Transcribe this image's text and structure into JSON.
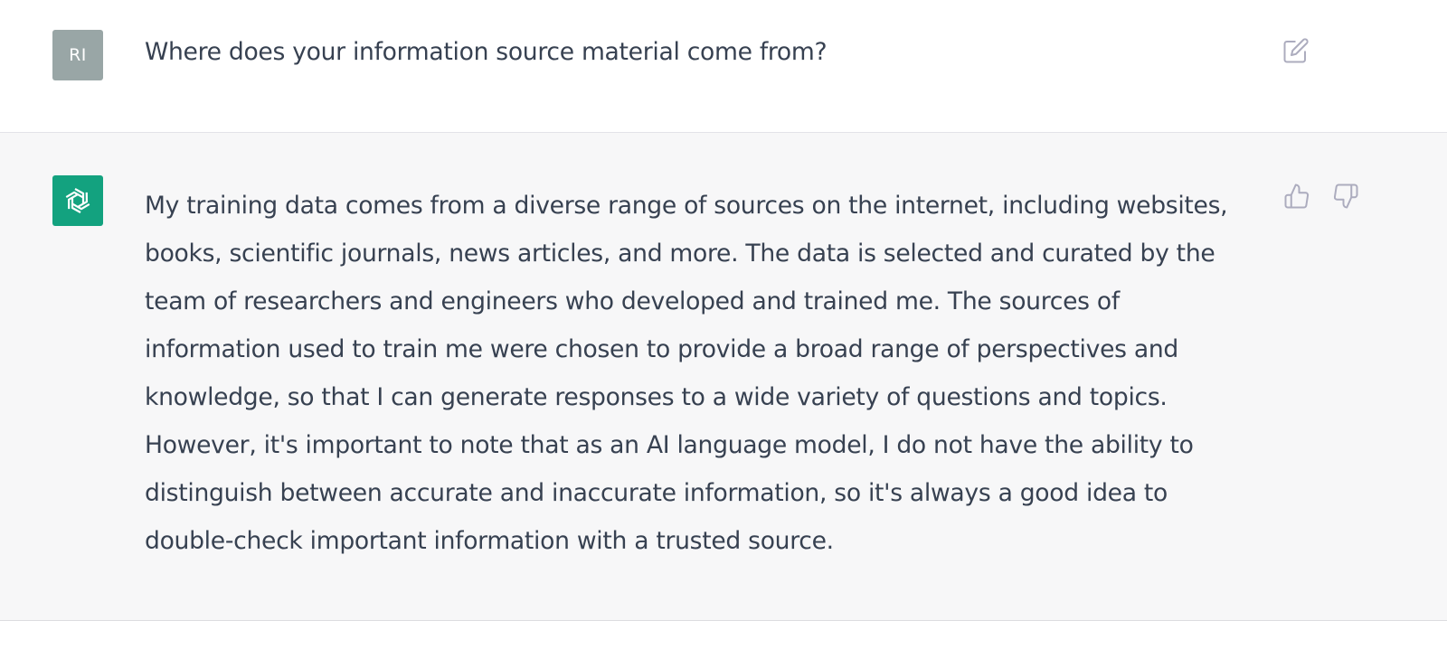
{
  "conversation": {
    "user_message": {
      "avatar_initials": "RI",
      "text": "Where does your information source material come from?",
      "edit_icon": "edit-icon"
    },
    "assistant_message": {
      "avatar_icon": "openai-logo-icon",
      "lines": [
        "My training data comes from a diverse range of sources on the internet, including websites,",
        "books, scientific journals, news articles, and more. The data is selected and curated by the",
        "team of researchers and engineers who developed and trained me. The sources of",
        "information used to train me were chosen to provide a broad range of perspectives and",
        "knowledge, so that I can generate responses to a wide variety of questions and topics.",
        "However, it's important to note that as an AI language model, I do not have the ability to",
        "distinguish between accurate and inaccurate information, so it's always a good idea to",
        "double-check important information with a trusted source."
      ],
      "feedback_icons": [
        "thumbs-up-icon",
        "thumbs-down-icon"
      ]
    }
  },
  "colors": {
    "user_avatar_bg": "#99a6a6",
    "assistant_avatar_bg": "#13a27f",
    "assistant_row_bg": "#f7f7f8",
    "text": "#374151",
    "icon": "#acacbe"
  }
}
